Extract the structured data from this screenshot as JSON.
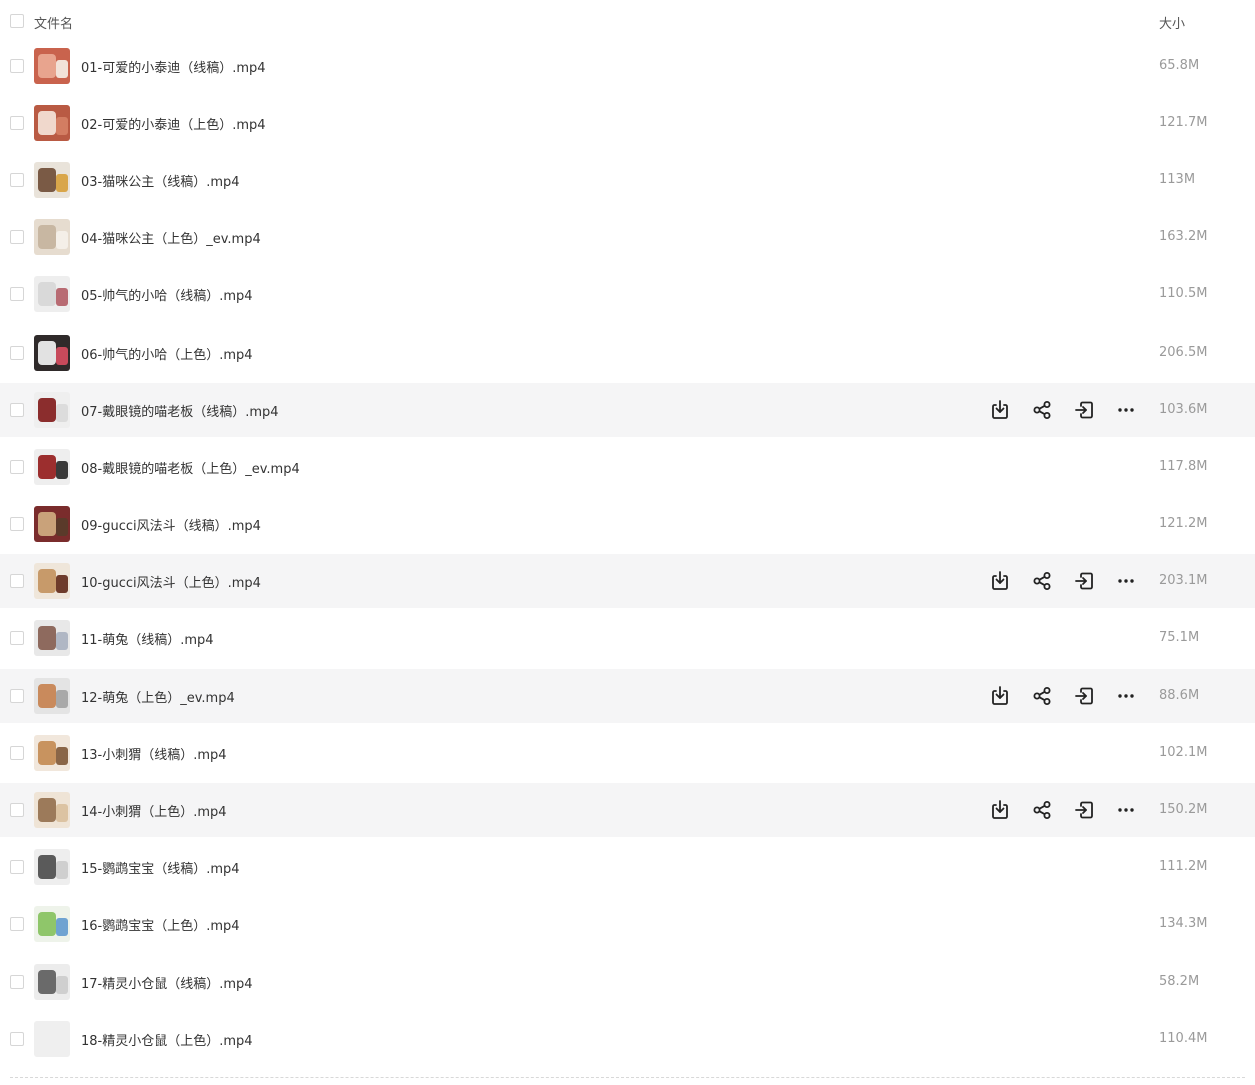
{
  "header": {
    "name_label": "文件名",
    "size_label": "大小"
  },
  "files": [
    {
      "name": "01-可爱的小泰迪（线稿）.mp4",
      "size": "65.8M",
      "thumb": [
        "#c9634d",
        "#e8a48e",
        "#f2e2d8"
      ]
    },
    {
      "name": "02-可爱的小泰迪（上色）.mp4",
      "size": "121.7M",
      "thumb": [
        "#b95a43",
        "#f0d8cc",
        "#d37d62"
      ]
    },
    {
      "name": "03-猫咪公主（线稿）.mp4",
      "size": "113M",
      "thumb": [
        "#e9e3da",
        "#7a5a45",
        "#d9a64a"
      ]
    },
    {
      "name": "04-猫咪公主（上色）_ev.mp4",
      "size": "163.2M",
      "thumb": [
        "#e6dccf",
        "#c8b7a2",
        "#f4efe8"
      ]
    },
    {
      "name": "05-帅气的小哈（线稿）.mp4",
      "size": "110.5M",
      "thumb": [
        "#eeeeee",
        "#d9d9d9",
        "#b86b73"
      ]
    },
    {
      "name": "06-帅气的小哈（上色）.mp4",
      "size": "206.5M",
      "thumb": [
        "#2f2a2a",
        "#e2e2e2",
        "#c74a5b"
      ]
    },
    {
      "name": "07-戴眼镜的喵老板（线稿）.mp4",
      "size": "103.6M",
      "thumb": [
        "#efefef",
        "#8b2d2d",
        "#dcdcdc"
      ]
    },
    {
      "name": "08-戴眼镜的喵老板（上色）_ev.mp4",
      "size": "117.8M",
      "thumb": [
        "#eeeeee",
        "#9c2e2e",
        "#3a3a3a"
      ]
    },
    {
      "name": "09-gucci风法斗（线稿）.mp4",
      "size": "121.2M",
      "thumb": [
        "#7a2c2c",
        "#c9a27a",
        "#5a3a2a"
      ]
    },
    {
      "name": "10-gucci风法斗（上色）.mp4",
      "size": "203.1M",
      "thumb": [
        "#efe6da",
        "#c79a6a",
        "#6e3b2a"
      ]
    },
    {
      "name": "11-萌兔（线稿）.mp4",
      "size": "75.1M",
      "thumb": [
        "#e8e8e8",
        "#8e6a5e",
        "#b0b7c4"
      ]
    },
    {
      "name": "12-萌兔（上色）_ev.mp4",
      "size": "88.6M",
      "thumb": [
        "#e4e4e4",
        "#c98a5c",
        "#a9a9a9"
      ]
    },
    {
      "name": "13-小刺猬（线稿）.mp4",
      "size": "102.1M",
      "thumb": [
        "#f1e7dc",
        "#c8935f",
        "#8a6648"
      ]
    },
    {
      "name": "14-小刺猬（上色）.mp4",
      "size": "150.2M",
      "thumb": [
        "#efe4d6",
        "#9c7a5a",
        "#dcc3a2"
      ]
    },
    {
      "name": "15-鹦鹉宝宝（线稿）.mp4",
      "size": "111.2M",
      "thumb": [
        "#eeeeee",
        "#5a5a5a",
        "#cfcfcf"
      ]
    },
    {
      "name": "16-鹦鹉宝宝（上色）.mp4",
      "size": "134.3M",
      "thumb": [
        "#eef3ea",
        "#8fc66a",
        "#6fa3d1"
      ]
    },
    {
      "name": "17-精灵小仓鼠（线稿）.mp4",
      "size": "58.2M",
      "thumb": [
        "#ececec",
        "#6a6a6a",
        "#cfcfcf"
      ]
    },
    {
      "name": "18-精灵小仓鼠（上色）.mp4",
      "size": "110.4M",
      "thumb": [
        "#efefef",
        "#efefef",
        "#efefef"
      ]
    }
  ],
  "hovered_rows": [
    6,
    9,
    11,
    13
  ],
  "row_actions": [
    {
      "icon": "download-icon",
      "label": "下载"
    },
    {
      "icon": "share-icon",
      "label": "分享"
    },
    {
      "icon": "move-icon",
      "label": "移动"
    },
    {
      "icon": "more-icon",
      "label": "更多"
    }
  ]
}
